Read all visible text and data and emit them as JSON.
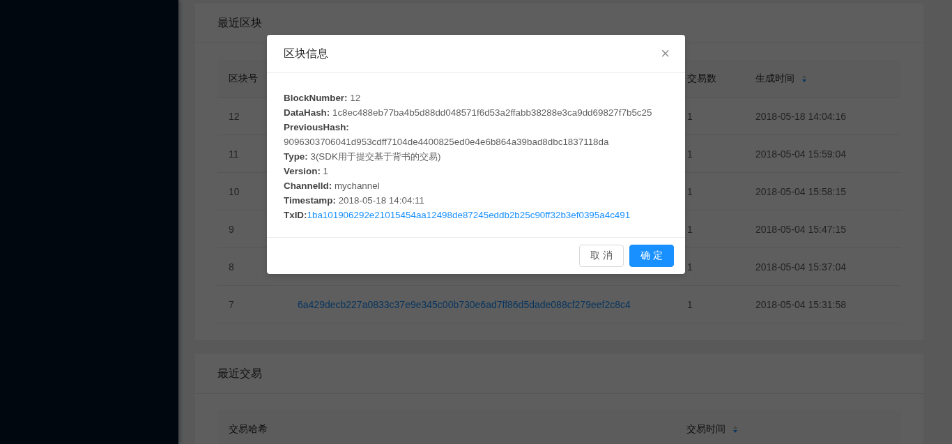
{
  "cards": [
    {
      "kind": "blocks",
      "title": "最近区块",
      "columns": [
        {
          "label": "区块号"
        },
        {
          "label": "交易数"
        },
        {
          "label": "生成时间",
          "descending": true
        }
      ],
      "rows": [
        {
          "number": "12",
          "count": "1",
          "time": "2018-05-18 14:04:16"
        },
        {
          "number": "11",
          "count": "1",
          "time": "2018-05-04 15:59:04"
        },
        {
          "number": "10",
          "count": "1",
          "time": "2018-05-04 15:58:15"
        },
        {
          "number": "9",
          "count": "1",
          "time": "2018-05-04 15:47:15"
        },
        {
          "number": "8",
          "count": "1",
          "time": "2018-05-04 15:37:04"
        },
        {
          "number": "7",
          "hash": "6a429decb227a0833c37e9e345c00b730e6ad7ff86d5dade088cf279eef2c8c4",
          "count": "1",
          "time": "2018-05-04 15:31:58"
        }
      ]
    },
    {
      "kind": "transactions",
      "title": "最近交易",
      "columns": [
        {
          "label": "交易哈希"
        },
        {
          "label": "交易时间",
          "descending": true
        }
      ]
    }
  ],
  "modal": {
    "title": "区块信息",
    "close": "×",
    "fields": [
      {
        "kind": "text",
        "label": "BlockNumber:",
        "value": "12"
      },
      {
        "kind": "text",
        "label": "DataHash:",
        "value": "1c8ec488eb77ba4b5d88dd048571f6d53a2ffabb38288e3ca9dd69827f7b5c25"
      },
      {
        "kind": "break",
        "label": "PreviousHash:",
        "value": "9096303706041d953cdff7104de4400825ed0e4e6b864a39bad8dbc1837118da"
      },
      {
        "kind": "text",
        "label": "Type:",
        "value": "3(SDK用于提交基于背书的交易)"
      },
      {
        "kind": "text",
        "label": "Version:",
        "value": "1"
      },
      {
        "kind": "text",
        "label": "ChannelId:",
        "value": "mychannel"
      },
      {
        "kind": "text",
        "label": "Timestamp:",
        "value": "2018-05-18 14:04:11"
      },
      {
        "kind": "link",
        "label": "TxID:",
        "value": "1ba101906292e21015454aa12498de87245eddb2b25c90ff32b3ef0395a4c491"
      }
    ],
    "buttons": [
      {
        "label": "取 消",
        "kind": "default"
      },
      {
        "label": "确 定",
        "kind": "primary"
      }
    ]
  }
}
